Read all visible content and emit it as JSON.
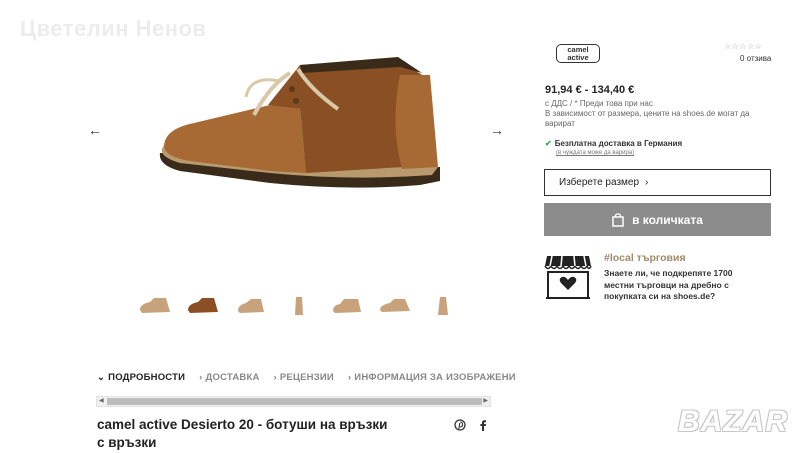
{
  "watermark": {
    "top_text": "Цветелин Ненов",
    "bottom_text": "BAZAR"
  },
  "gallery": {
    "prev_arrow": "←",
    "next_arrow": "→"
  },
  "tabs": [
    {
      "label": "ПОДРОБНОСТИ",
      "mark": "⌄",
      "active": true
    },
    {
      "label": "ДОСТАВКА",
      "mark": "›",
      "active": false
    },
    {
      "label": "РЕЦЕНЗИИ",
      "mark": "›",
      "active": false
    },
    {
      "label": "ИНФОРМАЦИЯ ЗА ИЗОБРАЖЕНИ",
      "mark": "›",
      "active": false
    }
  ],
  "scrollbar": {
    "left_arrow": "◀",
    "right_arrow": "▶"
  },
  "product": {
    "title": "camel active Desierto 20 - ботуши на връзки с връзки"
  },
  "brand": {
    "logo_line1": "camel",
    "logo_line2": "active"
  },
  "rating": {
    "stars": "☆☆☆☆☆",
    "reviews": "0 отзива"
  },
  "pricing": {
    "price": "91,94 € - 134,40 €",
    "vat": "с ДДС  /  * Преди това при нас",
    "note": "В зависимост от размера, цените на shoes.de могат да варират"
  },
  "shipping": {
    "check": "✔",
    "label": "Безплатна доставка в Германия",
    "sub": "(в чуждата може да варира)"
  },
  "size_select": {
    "label": "Изберете размер",
    "chevron": "›"
  },
  "cart_button": {
    "label": "в количката"
  },
  "local": {
    "title": "#local търговия",
    "text": "Знаете ли, че подкрепяте 1700 местни търговци на дребно с покупката си на shoes.de?"
  },
  "colors": {
    "accent_gold": "#a08a6a",
    "button_gray": "#8c8c8c",
    "check_green": "#3aa657"
  }
}
